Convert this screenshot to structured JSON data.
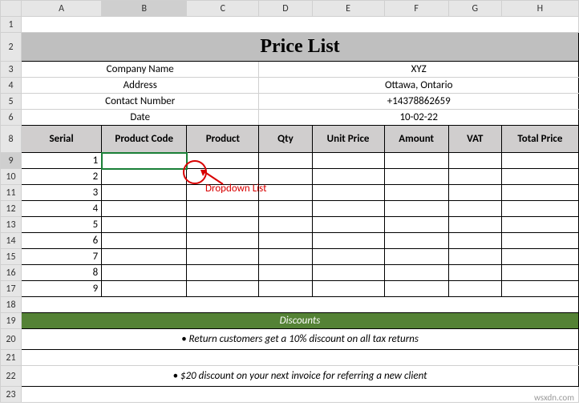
{
  "columns": [
    "A",
    "B",
    "C",
    "D",
    "E",
    "F",
    "G",
    "H"
  ],
  "row_numbers": [
    1,
    2,
    3,
    4,
    5,
    6,
    8,
    9,
    10,
    11,
    12,
    13,
    14,
    15,
    16,
    17,
    18,
    19,
    20,
    21,
    22,
    23
  ],
  "title": "Price List",
  "company": {
    "name_label": "Company Name",
    "name_value": "XYZ",
    "address_label": "Address",
    "address_value": "Ottawa, Ontario",
    "contact_label": "Contact Number",
    "contact_value": "+14378862659",
    "date_label": "Date",
    "date_value": "10-02-22"
  },
  "headers": {
    "serial": "Serial",
    "product_code": "Product Code",
    "product": "Product",
    "qty": "Qty",
    "unit_price": "Unit Price",
    "amount": "Amount",
    "vat": "VAT",
    "total_price": "Total Price"
  },
  "serials": [
    "1",
    "2",
    "3",
    "4",
    "5",
    "6",
    "7",
    "8",
    "9"
  ],
  "discounts": {
    "header": "Discounts",
    "line1": "• Return customers get a 10% discount on all tax returns",
    "line2": "• $20 discount on your next invoice for referring a new client"
  },
  "annotation": "Dropdown List",
  "watermark": "wsxdn.com",
  "active_cell": "B9"
}
